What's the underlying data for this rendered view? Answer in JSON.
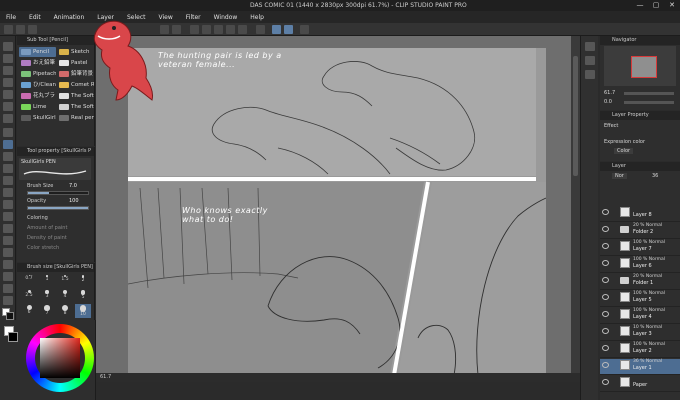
{
  "window": {
    "title": "DAS COMIC 01 (1440 x 2830px 300dpi 61.7%)  - CLIP STUDIO PAINT PRO",
    "buttons": [
      "—",
      "▢",
      "✕"
    ]
  },
  "menu": [
    "File",
    "Edit",
    "Animation",
    "Layer",
    "Select",
    "View",
    "Filter",
    "Window",
    "Help"
  ],
  "subtool": {
    "header": "Sub Tool [Pencil]",
    "brushes": [
      {
        "label": "Pencil",
        "color": "#7a9bbf"
      },
      {
        "label": "Sketch",
        "color": "#d9b24a"
      },
      {
        "label": "おえ鉛筆",
        "color": "#b07cc2"
      },
      {
        "label": "Pastel",
        "color": "#e6e6e6"
      },
      {
        "label": "Pipetachi",
        "color": "#7cc27a"
      },
      {
        "label": "鉛筆背景",
        "color": "#d16a6a"
      },
      {
        "label": "ひ/Clean",
        "color": "#6aa1d1"
      },
      {
        "label": "Comet Ru",
        "color": "#e6b94f"
      },
      {
        "label": "花丸ブラ",
        "color": "#c96bb0"
      },
      {
        "label": "The Soft",
        "color": "#e0e0e0"
      },
      {
        "label": "Lime",
        "color": "#7ad65a"
      },
      {
        "label": "The Soft",
        "color": "#d0d0d0"
      },
      {
        "label": "SkullGirls PEN",
        "color": "#5b5b5b"
      },
      {
        "label": "Real pencil",
        "color": "#6f6f6f"
      }
    ]
  },
  "toolprop": {
    "header": "Tool property [SkullGirls P",
    "preset_name": "SkullGirls PEN",
    "brush_size_label": "Brush Size",
    "brush_size_value": "7.0",
    "opacity_label": "Opacity",
    "opacity_value": "100",
    "opacity_fraction": 1.0,
    "rows": [
      "Coloring",
      "Amount of paint",
      "Density of paint",
      "Color stretch"
    ]
  },
  "brushsize": {
    "header": "Brush size [SkullGirls PEN]",
    "sizes": [
      "0.7",
      "1",
      "1.5",
      "2",
      "2.5",
      "3",
      "4",
      "5",
      "6",
      "7",
      "8",
      "10"
    ],
    "selected_index": 11
  },
  "canvas": {
    "zoom": "61.7",
    "caption1": "The hunting pair is led by a veteran female...",
    "caption2": "Who knows exactly what to do!"
  },
  "navigator": {
    "title": "Navigator",
    "zoom": "61.7",
    "angle": "0.0"
  },
  "layerprop": {
    "title": "Layer Property",
    "effect_label": "Effect",
    "expression_color_label": "Expression color",
    "color_value": "Color"
  },
  "layers": {
    "title": "Layer",
    "blend_header": "Nor",
    "opacity_header": "36",
    "items": [
      {
        "blend": "",
        "name": "Layer 8",
        "folder": false,
        "selected": false
      },
      {
        "blend": "20 % Normal",
        "name": "Folder 2",
        "folder": true,
        "selected": false
      },
      {
        "blend": "100 % Normal",
        "name": "Layer 7",
        "folder": false,
        "selected": false
      },
      {
        "blend": "100 % Normal",
        "name": "Layer 6",
        "folder": false,
        "selected": false
      },
      {
        "blend": "20 % Normal",
        "name": "Folder 1",
        "folder": true,
        "selected": false
      },
      {
        "blend": "100 % Normal",
        "name": "Layer 5",
        "folder": false,
        "selected": false
      },
      {
        "blend": "100 % Normal",
        "name": "Layer 4",
        "folder": false,
        "selected": false
      },
      {
        "blend": "10 % Normal",
        "name": "Layer 3",
        "folder": false,
        "selected": false
      },
      {
        "blend": "100 % Normal",
        "name": "Layer 2",
        "folder": false,
        "selected": false
      },
      {
        "blend": "36 % Normal",
        "name": "Layer 1",
        "folder": false,
        "selected": true
      },
      {
        "blend": "",
        "name": "Paper",
        "folder": false,
        "selected": false
      }
    ]
  }
}
